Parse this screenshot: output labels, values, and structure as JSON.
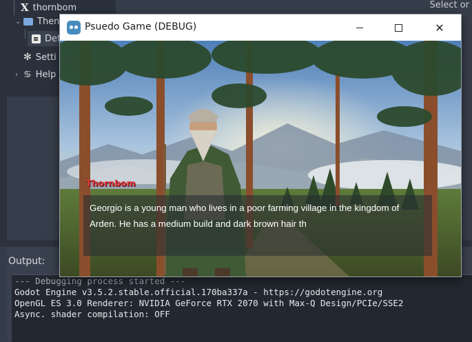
{
  "editor": {
    "tree_items": [
      {
        "label": "thornbom"
      },
      {
        "label": "Then"
      },
      {
        "label": "Def"
      },
      {
        "label": "Setti"
      },
      {
        "label": "Help"
      }
    ],
    "select_mode_label": "Select or"
  },
  "output": {
    "label": "Output:",
    "lines": [
      "--- Debugging process started ---",
      "Godot Engine v3.5.2.stable.official.170ba337a - https://godotengine.org",
      "OpenGL ES 3.0 Renderer: NVIDIA GeForce RTX 2070 with Max-Q Design/PCIe/SSE2",
      "Async. shader compilation: OFF"
    ]
  },
  "game_window": {
    "title": "Psuedo Game (DEBUG)",
    "icon": "godot-icon",
    "controls": {
      "minimize": "minimize-icon",
      "maximize": "maximize-icon",
      "close": "close-icon"
    }
  },
  "dialog": {
    "speaker": "Thornbom",
    "text": "Georgio is a young man who lives in a poor farming village in the kingdom of Arden. He has a medium build and dark brown hair th"
  },
  "colors": {
    "editor_bg": "#373e4b",
    "speaker_name": "#e2383d",
    "godot_blue": "#478cbf"
  }
}
